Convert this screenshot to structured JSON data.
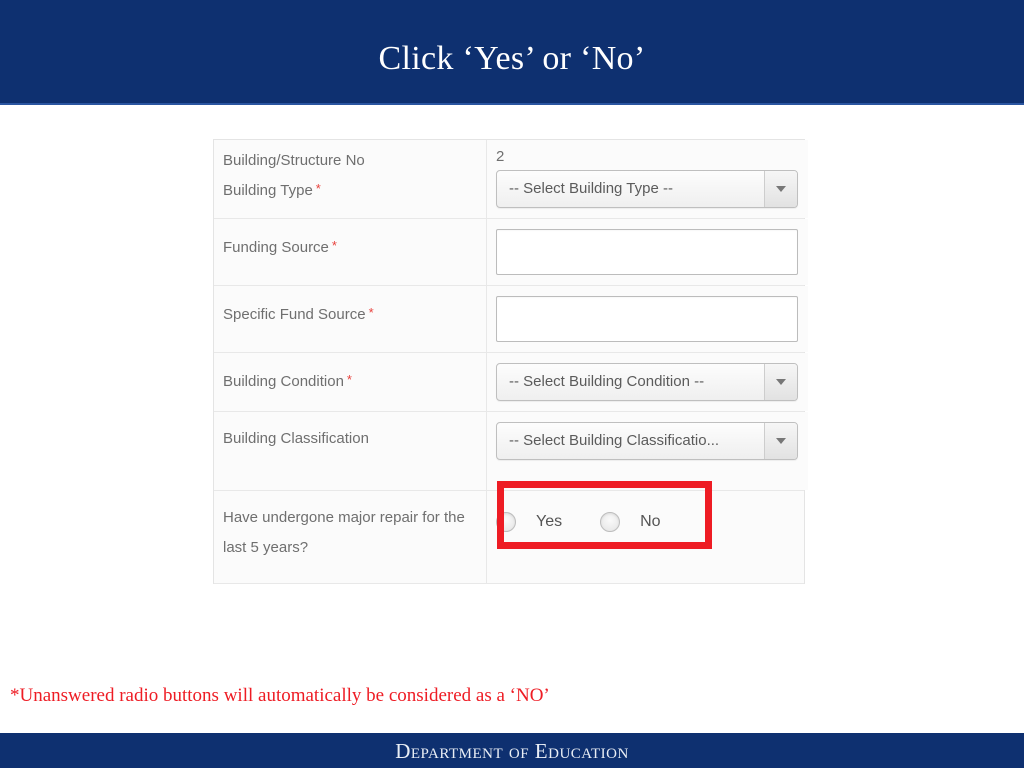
{
  "slide": {
    "title": "Click ‘Yes’ or ‘No’",
    "footnote": "*Unanswered radio buttons will automatically be considered as a ‘NO’",
    "footer_brand": "Department of Education",
    "colors": {
      "banner_navy": "#0e3070",
      "banner_rule": "#2a55a0",
      "highlight_red": "#ee1c24",
      "required_asterisk": "#e8413c",
      "label_gray": "#6f6f6f"
    }
  },
  "form": {
    "rows": [
      {
        "label": "Building/Structure No",
        "label2": "Building Type",
        "required": true,
        "required2": true,
        "value_text": "2",
        "control": "select",
        "control_value": "-- Select Building Type --"
      },
      {
        "label": "Funding Source",
        "required": true,
        "control": "text",
        "control_value": ""
      },
      {
        "label": "Specific Fund Source",
        "required": true,
        "control": "text",
        "control_value": ""
      },
      {
        "label": "Building Condition",
        "required": true,
        "control": "select",
        "control_value": "-- Select Building Condition --"
      },
      {
        "label": "Building Classification",
        "required": false,
        "control": "select",
        "control_value": "-- Select Building Classificatio..."
      },
      {
        "label": "Have undergone major repair for the last 5 years?",
        "required": false,
        "control": "radio",
        "options": [
          {
            "label": "Yes",
            "selected": false
          },
          {
            "label": "No",
            "selected": false
          }
        ]
      }
    ],
    "required_marker": "*"
  }
}
